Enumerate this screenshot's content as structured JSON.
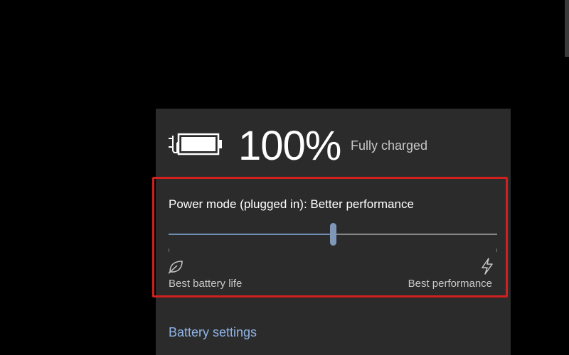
{
  "battery": {
    "percent_text": "100%",
    "status": "Fully charged",
    "charge_level": 1.0,
    "plugged_in": true
  },
  "power_mode": {
    "label": "Power mode (plugged in): Better performance",
    "slider_value": 0.5,
    "min_label": "Best battery life",
    "max_label": "Best performance"
  },
  "links": {
    "battery_settings": "Battery settings"
  },
  "icons": {
    "battery": "battery-charging-icon",
    "min": "leaf-icon",
    "max": "lightning-bolt-icon"
  },
  "colors": {
    "flyout_bg": "#2b2b2b",
    "highlight_border": "#d21f1f",
    "slider_accent": "#7f98b8",
    "link": "#8fb4e8"
  }
}
